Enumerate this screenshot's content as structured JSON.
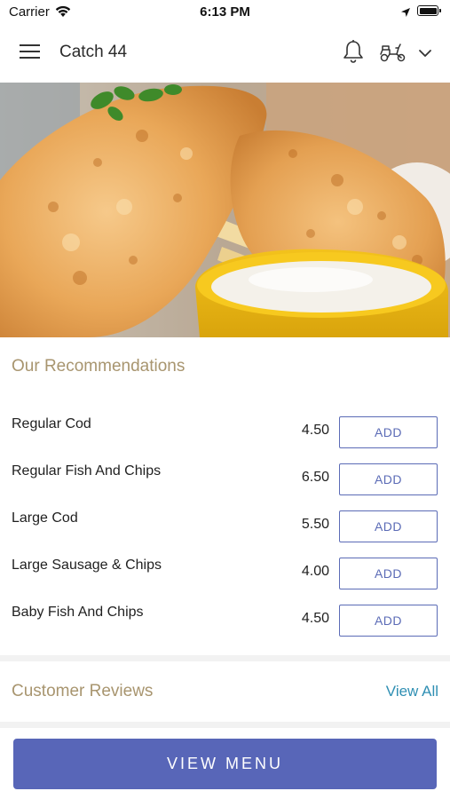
{
  "status_bar": {
    "carrier": "Carrier",
    "time": "6:13 PM",
    "icons": [
      "wifi-icon",
      "location-arrow-icon",
      "battery-icon"
    ]
  },
  "header": {
    "title": "Catch 44",
    "icons": [
      "hamburger-menu-icon",
      "bell-icon",
      "delivery-scooter-icon",
      "chevron-down-icon"
    ]
  },
  "hero": {
    "image": "fried fish fillets with chips and tartar sauce"
  },
  "recommendations": {
    "title": "Our Recommendations",
    "items": [
      {
        "name": "Regular Cod",
        "price": "4.50",
        "button": "ADD"
      },
      {
        "name": "Regular Fish And Chips",
        "price": "6.50",
        "button": "ADD"
      },
      {
        "name": "Large Cod",
        "price": "5.50",
        "button": "ADD"
      },
      {
        "name": "Large Sausage & Chips",
        "price": "4.00",
        "button": "ADD"
      },
      {
        "name": "Baby Fish  And Chips",
        "price": "4.50",
        "button": "ADD"
      }
    ]
  },
  "reviews": {
    "title": "Customer Reviews",
    "view_all": "View All"
  },
  "footer": {
    "view_menu": "VIEW MENU"
  },
  "colors": {
    "accent": "#5866b8",
    "section_title": "#a8956f",
    "link": "#2f8fb3"
  }
}
